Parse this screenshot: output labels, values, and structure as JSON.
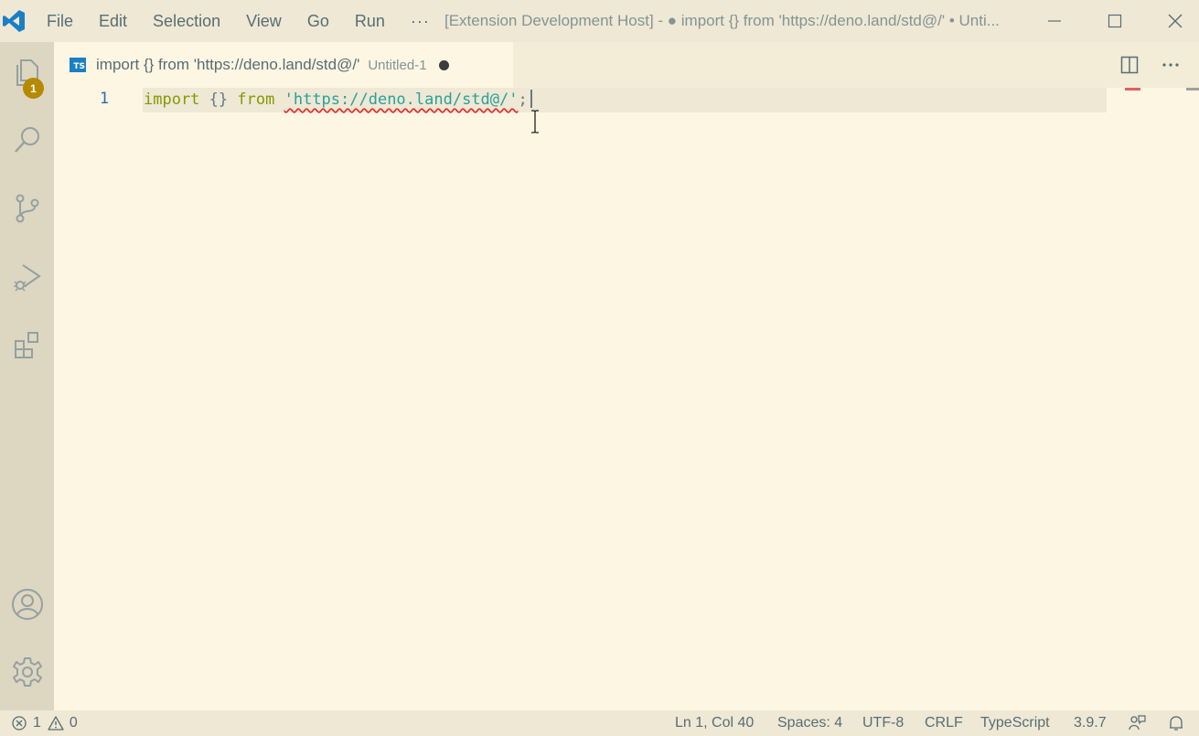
{
  "menu": {
    "file": "File",
    "edit": "Edit",
    "selection": "Selection",
    "view": "View",
    "go": "Go",
    "run": "Run",
    "more": "···"
  },
  "window_title": "[Extension Development Host] - ● import {} from 'https://deno.land/std@/' • Unti...",
  "activity_bar": {
    "explorer_badge": "1"
  },
  "tab": {
    "icon_text": "TS",
    "title": "import {} from 'https://deno.land/std@/'",
    "description": "Untitled-1"
  },
  "editor": {
    "line_number": "1",
    "tokens": {
      "keyword_import": "import",
      "braces": "{}",
      "keyword_from": "from",
      "string": "'https://deno.land/std@/'",
      "semicolon": ";"
    }
  },
  "status": {
    "errors": "1",
    "warnings": "0",
    "position": "Ln 1, Col 40",
    "spaces": "Spaces: 4",
    "encoding": "UTF-8",
    "eol": "CRLF",
    "language": "TypeScript",
    "version": "3.9.7"
  },
  "colors": {
    "background": "#fdf6e3",
    "keyword": "#859900",
    "string": "#2aa198",
    "error": "#dc322f",
    "badge": "#b58900"
  }
}
